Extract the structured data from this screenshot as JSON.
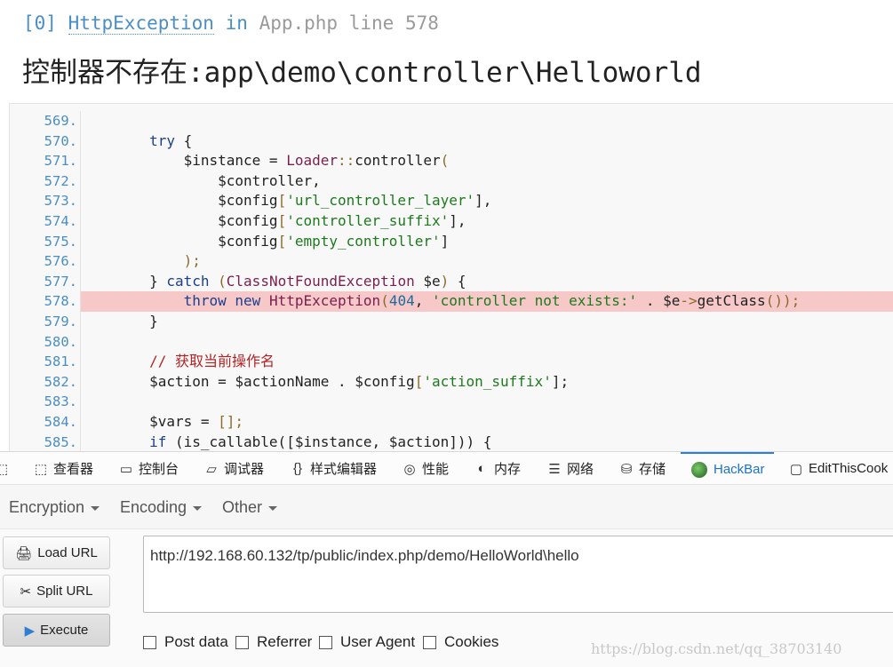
{
  "exception": {
    "index": "[0]",
    "class_name": "HttpException",
    "in_word": "in",
    "file": "App.php",
    "line_word": "line",
    "line": "578",
    "message": "控制器不存在:app\\demo\\controller\\Helloworld"
  },
  "source": {
    "line_numbers": [
      "569.",
      "570.",
      "571.",
      "572.",
      "573.",
      "574.",
      "575.",
      "576.",
      "577.",
      "578.",
      "579.",
      "580.",
      "581.",
      "582.",
      "583.",
      "584.",
      "585."
    ],
    "highlighted_line": "578."
  },
  "devtools": {
    "tabs": [
      {
        "label": "查看器",
        "icon": "inspector-icon"
      },
      {
        "label": "控制台",
        "icon": "console-icon"
      },
      {
        "label": "调试器",
        "icon": "debugger-icon"
      },
      {
        "label": "样式编辑器",
        "icon": "style-editor-icon"
      },
      {
        "label": "性能",
        "icon": "performance-icon"
      },
      {
        "label": "内存",
        "icon": "memory-icon"
      },
      {
        "label": "网络",
        "icon": "network-icon"
      },
      {
        "label": "存储",
        "icon": "storage-icon"
      },
      {
        "label": "HackBar",
        "icon": "hackbar-icon"
      },
      {
        "label": "EditThisCook",
        "icon": "editthiscookie-icon"
      }
    ],
    "active_tab": "HackBar"
  },
  "hackbar": {
    "menus": [
      "Encryption",
      "Encoding",
      "Other"
    ],
    "buttons": {
      "load_url": "Load URL",
      "split_url": "Split URL",
      "execute": "Execute"
    },
    "url": "http://192.168.60.132/tp/public/index.php/demo/HelloWorld\\hello",
    "options": [
      "Post data",
      "Referrer",
      "User Agent",
      "Cookies"
    ]
  },
  "watermark": "https://blog.csdn.net/qq_38703140",
  "colors": {
    "link_blue": "#4a8ec5",
    "error_highlight": "#f6c8c8",
    "active_tab_blue": "#1a73c8"
  }
}
